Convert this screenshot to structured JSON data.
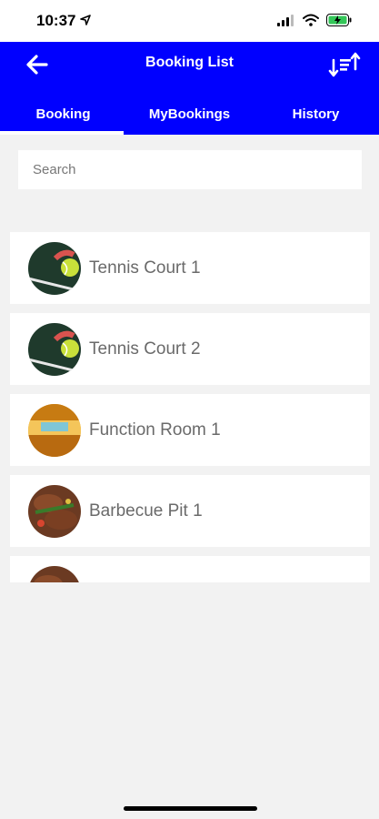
{
  "status_bar": {
    "time": "10:37"
  },
  "header": {
    "title": "Booking List",
    "background_color": "#0000ff",
    "back_icon": "arrow-left-icon",
    "sort_icon": "sort-icon"
  },
  "tabs": [
    {
      "label": "Booking",
      "active": true
    },
    {
      "label": "MyBookings",
      "active": false
    },
    {
      "label": "History",
      "active": false
    }
  ],
  "search": {
    "placeholder": "Search",
    "value": ""
  },
  "items": [
    {
      "label": "Tennis Court 1",
      "image": "tennis-ball-image"
    },
    {
      "label": "Tennis Court 2",
      "image": "tennis-ball-image"
    },
    {
      "label": "Function Room 1",
      "image": "function-room-image"
    },
    {
      "label": "Barbecue Pit 1",
      "image": "barbecue-image"
    },
    {
      "label": "",
      "image": "barbecue-image"
    }
  ]
}
